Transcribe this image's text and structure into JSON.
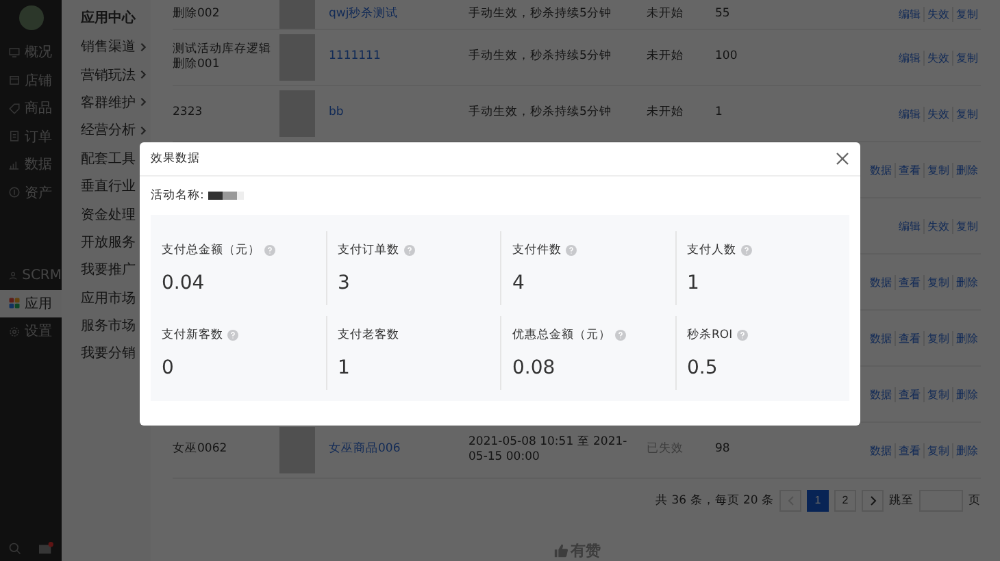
{
  "sidebar": {
    "items": [
      {
        "label": "概况",
        "selected": false
      },
      {
        "label": "店铺",
        "selected": false
      },
      {
        "label": "商品",
        "selected": false
      },
      {
        "label": "订单",
        "selected": false
      },
      {
        "label": "数据",
        "selected": false
      },
      {
        "label": "资产",
        "selected": false
      },
      {
        "label": "SCRM",
        "selected": false
      },
      {
        "label": "应用",
        "selected": true
      },
      {
        "label": "设置",
        "selected": false
      }
    ]
  },
  "subnav": {
    "title": "应用中心",
    "submenus": [
      "销售渠道",
      "营销玩法",
      "客群维护",
      "经营分析"
    ],
    "links": [
      "配套工具",
      "垂直行业",
      "资金处理",
      "开放服务",
      "我要推广",
      "应用市场",
      "服务市场",
      "我要分销"
    ]
  },
  "table": {
    "rows": [
      {
        "name": "删除002",
        "product": "qwj秒杀测试",
        "effect": "手动生效，秒杀持续5分钟",
        "status": "未开始",
        "stock": "55",
        "expired": false,
        "actions": [
          "编辑",
          "失效",
          "复制"
        ]
      },
      {
        "name": "测试活动库存逻辑删除001",
        "product": "1111111",
        "effect": "手动生效，秒杀持续5分钟",
        "status": "未开始",
        "stock": "100",
        "expired": false,
        "actions": [
          "编辑",
          "失效",
          "复制"
        ]
      },
      {
        "name": "2323",
        "product": "bb",
        "effect": "手动生效，秒杀持续5分钟",
        "status": "未开始",
        "stock": "1",
        "expired": false,
        "actions": [
          "编辑",
          "失效",
          "复制"
        ]
      },
      {
        "actions": [
          "数据",
          "查看",
          "复制",
          "删除"
        ]
      },
      {
        "actions": [
          "编辑",
          "失效",
          "复制"
        ]
      },
      {
        "actions": [
          "数据",
          "查看",
          "复制",
          "删除"
        ]
      },
      {
        "actions": [
          "数据",
          "查看",
          "复制",
          "删除"
        ]
      },
      {
        "actions": [
          "数据",
          "查看",
          "复制",
          "删除"
        ]
      },
      {
        "name": "女巫0062",
        "product": "女巫商品006",
        "effect": "2021-05-08 10:51 至 2021-05-15 00:00",
        "status": "已失效",
        "stock": "98",
        "expired": true,
        "actions": [
          "数据",
          "查看",
          "复制",
          "删除"
        ]
      }
    ]
  },
  "pagination": {
    "summary": "共 36 条，每页 20 条",
    "pages": [
      {
        "label": "1",
        "selected": true
      },
      {
        "label": "2",
        "selected": false
      }
    ],
    "prev_disabled": true,
    "jump_label": "跳至",
    "jump_suffix": "页"
  },
  "footer": {
    "brand": "有赞"
  },
  "modal": {
    "title": "效果数据",
    "activity_label": "活动名称:",
    "metrics": [
      {
        "label": "支付总金额（元）",
        "value": "0.04",
        "help": true
      },
      {
        "label": "支付订单数",
        "value": "3",
        "help": true
      },
      {
        "label": "支付件数",
        "value": "4",
        "help": true
      },
      {
        "label": "支付人数",
        "value": "1",
        "help": true
      },
      {
        "label": "支付新客数",
        "value": "0",
        "help": true
      },
      {
        "label": "支付老客数",
        "value": "1",
        "help": false
      },
      {
        "label": "优惠总金额（元）",
        "value": "0.08",
        "help": true
      },
      {
        "label": "秒杀ROI",
        "value": "0.5",
        "help": true
      }
    ]
  }
}
